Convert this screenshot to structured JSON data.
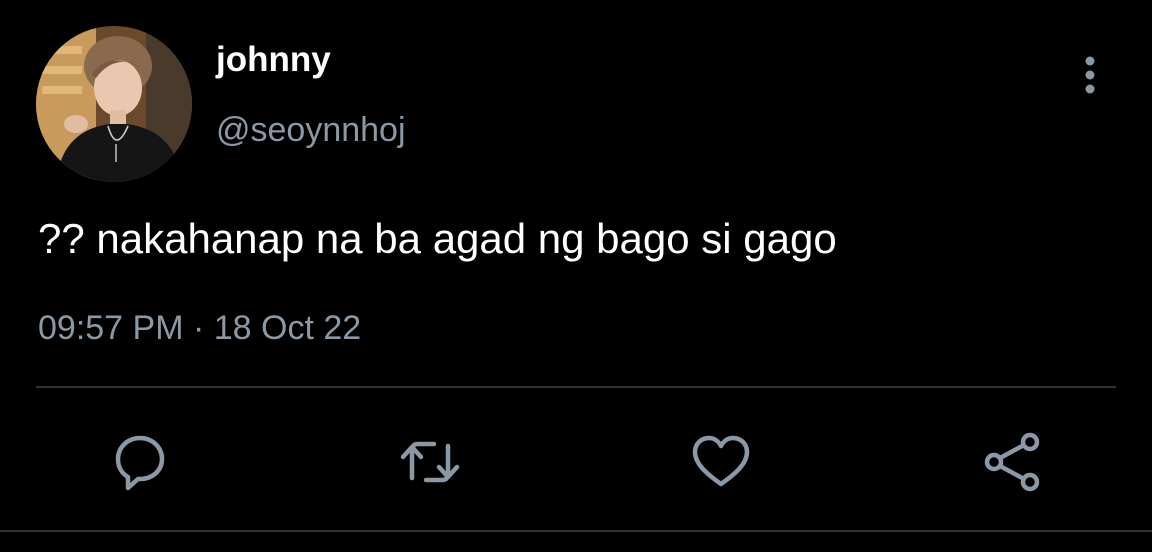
{
  "tweet": {
    "display_name": "johnny",
    "handle": "@seoynnhoj",
    "text": "?? nakahanap na ba agad ng bago si gago",
    "time": "09:57 PM",
    "separator": "·",
    "date": "18 Oct 22"
  },
  "icons": {
    "more": "vertical-ellipsis-icon",
    "reply": "speech-bubble-icon",
    "retweet": "retweet-arrows-icon",
    "like": "heart-icon",
    "share": "share-nodes-icon"
  },
  "colors": {
    "background": "#000000",
    "primary_text": "#ffffff",
    "secondary_text": "#8b98a5",
    "divider": "#2f3336",
    "icon": "#8b98a5"
  }
}
